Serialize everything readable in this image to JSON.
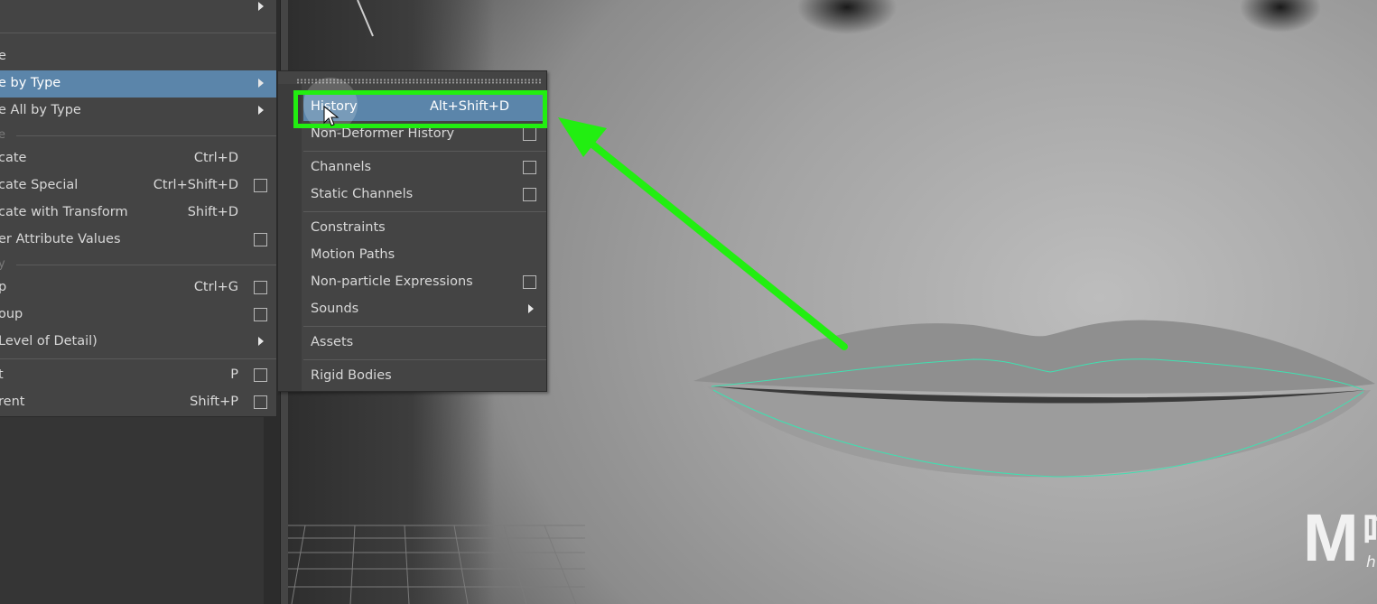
{
  "main_menu": {
    "items": [
      {
        "label": "e"
      },
      {
        "label": "e by Type",
        "has_submenu": true,
        "highlighted": true
      },
      {
        "label": "e All by Type",
        "has_submenu": true
      },
      {
        "label": "cate",
        "shortcut": "Ctrl+D"
      },
      {
        "label": "cate Special",
        "shortcut": "Ctrl+Shift+D",
        "option_box": true
      },
      {
        "label": "cate with Transform",
        "shortcut": "Shift+D"
      },
      {
        "label": "er Attribute Values",
        "option_box": true
      },
      {
        "label": "p",
        "shortcut": "Ctrl+G",
        "option_box": true
      },
      {
        "label": "oup",
        "option_box": true
      },
      {
        "label": "Level of Detail)",
        "has_submenu": true
      },
      {
        "label": "t",
        "shortcut": "P",
        "option_box": true
      },
      {
        "label": "rent",
        "shortcut": "Shift+P",
        "option_box": true
      }
    ],
    "sections": [
      "e",
      "y"
    ]
  },
  "sub_menu": {
    "items": [
      {
        "label": "History",
        "shortcut": "Alt+Shift+D",
        "highlighted": true
      },
      {
        "label": "Non-Deformer History",
        "option_box": true
      },
      {
        "label": "Channels",
        "option_box": true
      },
      {
        "label": "Static Channels",
        "option_box": true
      },
      {
        "label": "Constraints"
      },
      {
        "label": "Motion Paths"
      },
      {
        "label": "Non-particle Expressions",
        "option_box": true
      },
      {
        "label": "Sounds",
        "has_submenu": true
      },
      {
        "label": "Assets"
      },
      {
        "label": "Rigid Bodies"
      }
    ]
  },
  "watermark": {
    "logo_letter": "M",
    "name": "喵喵动画屋",
    "url": "https://miaodonghua.com"
  },
  "colors": {
    "menu_bg": "#444444",
    "highlight": "#5b85aa",
    "annotation": "#22ee11",
    "curve": "#3fe0b0"
  }
}
